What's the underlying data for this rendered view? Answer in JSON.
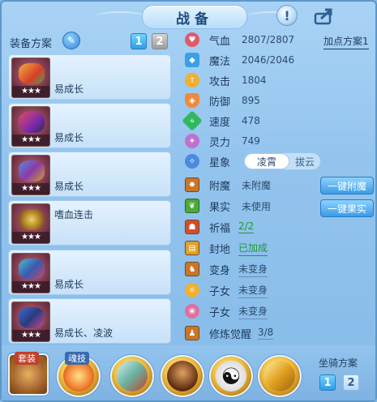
{
  "header": {
    "title": "战备"
  },
  "left": {
    "plan_label": "装备方案",
    "plan_tabs": [
      "1",
      "2"
    ],
    "slots": [
      {
        "stars": "★★★",
        "desc": "易成长",
        "color": "#d97a3a"
      },
      {
        "stars": "★★★",
        "desc": "易成长",
        "color": "#9a3fa8"
      },
      {
        "stars": "★★★",
        "desc": "易成长",
        "color": "#4b6fd0"
      },
      {
        "stars": "★★★",
        "desc": "嗜血连击",
        "color": "#c0a040"
      },
      {
        "stars": "★★★",
        "desc": "易成长",
        "color": "#3aa0c0"
      },
      {
        "stars": "★★★",
        "desc": "易成长、凌波",
        "color": "#2a5fb0"
      }
    ]
  },
  "stats": {
    "add_plan": "加点方案1",
    "rows": [
      {
        "icon": "heart-icon",
        "name": "气血",
        "value": "2807/2807",
        "color": "#e25a6a"
      },
      {
        "icon": "mana-icon",
        "name": "魔法",
        "value": "2046/2046",
        "color": "#3aa0e8"
      },
      {
        "icon": "sword-icon",
        "name": "攻击",
        "value": "1804",
        "color": "#f0b030"
      },
      {
        "icon": "shield-icon",
        "name": "防御",
        "value": "895",
        "color": "#f08a3a"
      },
      {
        "icon": "speed-icon",
        "name": "速度",
        "value": "478",
        "color": "#30b860"
      },
      {
        "icon": "spirit-icon",
        "name": "灵力",
        "value": "749",
        "color": "#c070d0"
      }
    ],
    "star": {
      "name": "星象",
      "on": "凌霄",
      "off": "拔云"
    },
    "extras": [
      {
        "icon": "enchant-icon",
        "name": "附魔",
        "value": "未附魔",
        "green": false
      },
      {
        "icon": "fruit-icon",
        "name": "果实",
        "value": "未使用",
        "green": false
      },
      {
        "icon": "pray-icon",
        "name": "祈福",
        "value": "2/2",
        "green": true
      },
      {
        "icon": "seal-icon",
        "name": "封地",
        "value": "已加成",
        "green": true
      },
      {
        "icon": "transform-icon",
        "name": "变身",
        "value": "未变身",
        "green": false
      },
      {
        "icon": "child-icon",
        "name": "子女",
        "value": "未变身",
        "green": false
      },
      {
        "icon": "child2-icon",
        "name": "子女",
        "value": "未变身",
        "green": false
      },
      {
        "icon": "cultivate-icon",
        "name": "修炼觉醒",
        "value": "3/8",
        "green": false
      }
    ],
    "btn_enchant": "一键附魔",
    "btn_fruit": "一键果实"
  },
  "bottom": {
    "slot1_tag": "套装",
    "slot2_tag": "魂技",
    "mount_label": "坐骑方案",
    "mount_tabs": [
      "1",
      "2"
    ]
  }
}
